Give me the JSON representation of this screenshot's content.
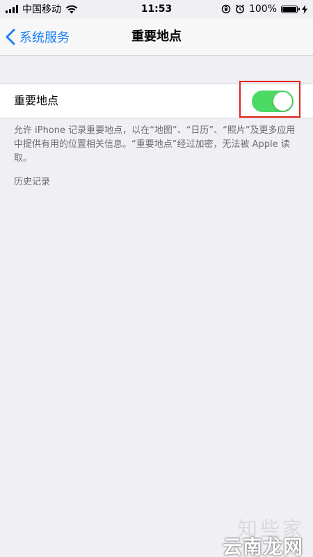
{
  "status_bar": {
    "carrier": "中国移动",
    "time": "11:53",
    "battery": "100%",
    "battery_level": 1.0
  },
  "nav": {
    "back_label": "系统服务",
    "title": "重要地点"
  },
  "setting": {
    "label": "重要地点",
    "toggle_on": true,
    "toggle_color": "#4cd964"
  },
  "description": "允许 iPhone 记录重要地点，以在“地图”、“日历”、“照片”及更多应用中提供有用的位置相关信息。“重要地点”经过加密，无法被 Apple 读取。",
  "history_header": "历史记录",
  "watermark": {
    "top": "知些家",
    "bottom": "云南龙网"
  },
  "colors": {
    "accent": "#1a7ef7",
    "highlight_box": "#e2231a",
    "background": "#efeff4"
  }
}
